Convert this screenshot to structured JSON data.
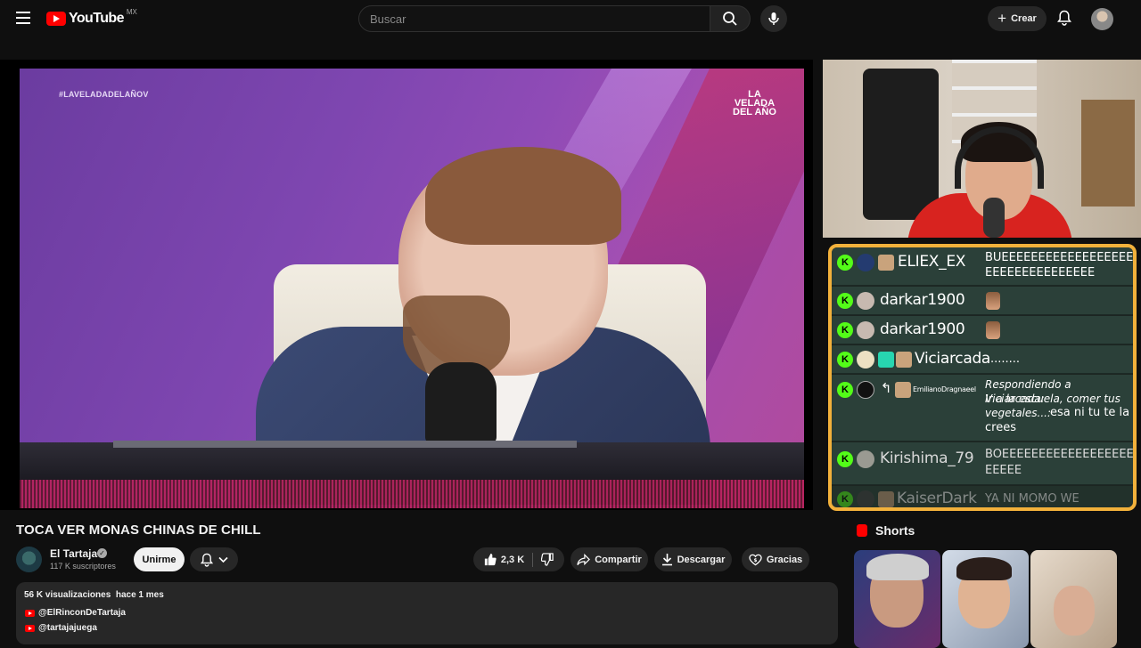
{
  "header": {
    "logo_text": "YouTube",
    "country_code": "MX",
    "search_placeholder": "Buscar",
    "create_label": "Crear"
  },
  "video": {
    "overlay_hashtag": "#LAVELADADELAÑOV",
    "title": "TOCA VER MONAS CHINAS DE CHILL"
  },
  "channel": {
    "name": "El Tartaja",
    "subscribers": "117 K suscriptores",
    "join_label": "Unirme"
  },
  "actions": {
    "like_count": "2,3 K",
    "share_label": "Compartir",
    "download_label": "Descargar",
    "thanks_label": "Gracias"
  },
  "description": {
    "views": "56 K visualizaciones",
    "date": "hace 1 mes",
    "links": [
      "@ElRinconDeTartaja",
      "@tartajajuega"
    ]
  },
  "chat": {
    "messages": [
      {
        "user": "ELIEX_EX",
        "text": "BUEEEEEEEEEEEEEEEEEEEEEEEEEEEEEEEEE",
        "text_line1": "BUEEEEEEEEEEEEEEEEEE",
        "text_line2": "EEEEEEEEEEEEEEE"
      },
      {
        "user": "darkar1900",
        "text": ""
      },
      {
        "user": "darkar1900",
        "text": ""
      },
      {
        "user": "Viciarcada",
        "text": "........"
      },
      {
        "user": "EmilianoDragnaeel",
        "reply": "Respondiendo a Viciarcada: Ir a la escuela, comer tus vegetales...:",
        "reply_line1": "Respondiendo a Viciarcada:",
        "reply_line2": "Ir a la escuela, comer tus",
        "reply_line3": "vegetales...:",
        "text": "esa ni tu te la",
        "text_line2": "crees"
      },
      {
        "user": "Kirishima_79",
        "text": "BOEEEEEEEEEEEEEEEEEEEEEEE",
        "text_line1": "BOEEEEEEEEEEEEEEEEEE",
        "text_line2": "EEEEE"
      },
      {
        "user": "KaiserDark",
        "text": "YA NI MOMO WE"
      }
    ]
  },
  "shorts": {
    "heading": "Shorts"
  },
  "colors": {
    "background": "#0f0f0f",
    "youtube_red": "#ff0000",
    "chat_border": "#f2b13b",
    "kick_green": "#53fc18"
  }
}
